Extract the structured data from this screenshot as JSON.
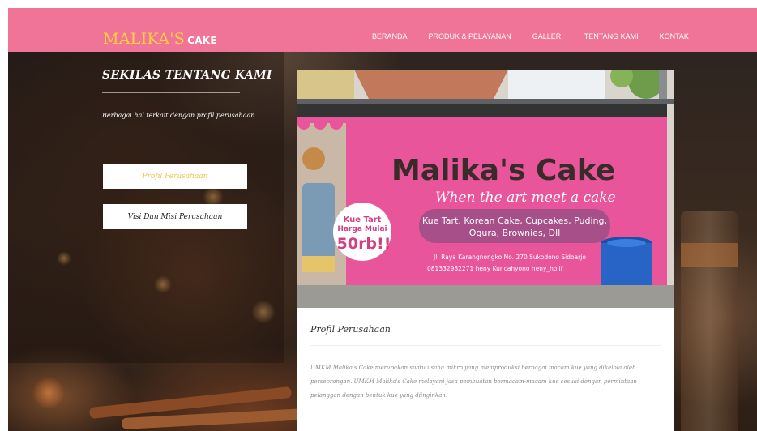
{
  "brand": {
    "name": "MALIKA'S",
    "suffix": "CAKE"
  },
  "nav": {
    "items": [
      "BERANDA",
      "PRODUK & PELAYANAN",
      "GALLERI",
      "TENTANG KAMI",
      "KONTAK"
    ]
  },
  "sidebar": {
    "title": "SEKILAS TENTANG KAMI",
    "description": "Berbagai hal terkait dengan profil perusahaan",
    "buttons": [
      "Profil Perusahaan",
      "Visi Dan Misi Perusahaan"
    ]
  },
  "photo": {
    "banner_title": "Malika's Cake",
    "banner_tagline": "When the art meet a cake",
    "banner_products": "Kue Tart, Korean Cake, Cupcakes, Puding,",
    "banner_products2": "Ogura, Brownies, Dll",
    "banner_promo_1": "Kue Tart",
    "banner_promo_2": "Harga Mulai",
    "banner_price": "50rb!!",
    "banner_address": "Jl. Raya Karangnongko No. 270 Sukodono Sidoarjo",
    "banner_contact": "081332982271  heny Kuncahyono  heny_holif"
  },
  "content": {
    "title": "Profil Perusahaan",
    "body": "UMKM Malika's Cake merupakan suatu usaha mikro yang memproduksi berbagai macam kue yang dikelola oleh perseorangan. UMKM Malika's Cake melayani jasa pembuatan bermacam-macam kue sesuai dengan permintaan pelanggan dengan bentuk kue yang diinginkan."
  },
  "colors": {
    "navbar": "#f07398",
    "brand": "#ffd23a",
    "banner_pink": "#e8559a",
    "active_button_text": "#f5c24c"
  }
}
